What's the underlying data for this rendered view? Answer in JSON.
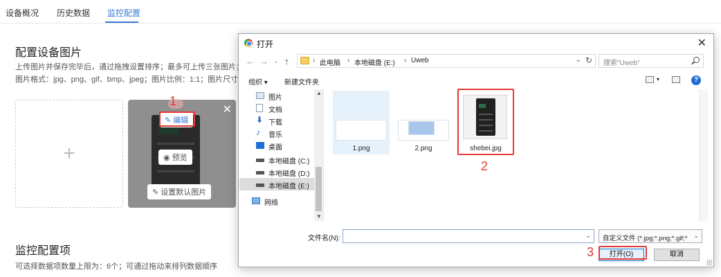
{
  "tabs": [
    {
      "label": "设备概况"
    },
    {
      "label": "历史数据"
    },
    {
      "label": "监控配置"
    }
  ],
  "config_image": {
    "title": "配置设备图片",
    "desc_line1": "上传图片并保存完毕后，通过拖拽设置排序；最多可上传三张图片；",
    "desc_line2": "图片格式：jpg、png、gif、bmp、jpeg；图片比例：1:1；图片尺寸",
    "card": {
      "edit_label": "编辑",
      "preview_label": "预览",
      "default_label": "设置默认图片"
    }
  },
  "monitor": {
    "title": "监控配置项",
    "desc": "可选择数据项数量上限为：6个；可通过拖动来排列数据顺序"
  },
  "steps": [
    "1",
    "2",
    "3"
  ],
  "dialog": {
    "title": "打开",
    "breadcrumb": [
      "此电脑",
      "本地磁盘 (E:)",
      "Uweb"
    ],
    "search_placeholder": "搜索\"Uweb\"",
    "toolbar": {
      "organize": "组织 ▾",
      "new_folder": "新建文件夹"
    },
    "nav_items": [
      {
        "label": "图片",
        "icon": "pictures-icon"
      },
      {
        "label": "文档",
        "icon": "documents-icon"
      },
      {
        "label": "下载",
        "icon": "download-icon"
      },
      {
        "label": "音乐",
        "icon": "music-icon"
      },
      {
        "label": "桌面",
        "icon": "desktop-icon"
      },
      {
        "label": "本地磁盘 (C:)",
        "icon": "drive-icon"
      },
      {
        "label": "本地磁盘 (D:)",
        "icon": "drive-icon"
      },
      {
        "label": "本地磁盘 (E:)",
        "icon": "drive-icon"
      },
      {
        "label": "网络",
        "icon": "network-icon"
      }
    ],
    "files": [
      {
        "name": "1.png"
      },
      {
        "name": "2.png"
      },
      {
        "name": "shebei.jpg"
      }
    ],
    "filename_label": "文件名(N):",
    "filename_value": "",
    "filter": "自定义文件 (*.jpg;*.png;*.gif;*",
    "open_label": "打开(O)",
    "cancel_label": "取消"
  },
  "colors": {
    "accent": "#3a7bd5",
    "highlight": "#e53935"
  }
}
